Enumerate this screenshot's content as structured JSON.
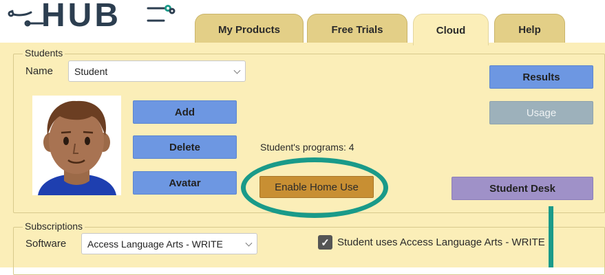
{
  "app": {
    "logo_text": "HUB"
  },
  "tabs": [
    {
      "label": "My Products"
    },
    {
      "label": "Free Trials"
    },
    {
      "label": "Cloud"
    },
    {
      "label": "Help"
    }
  ],
  "students_section": {
    "legend": "Students",
    "name_label": "Name",
    "name_select_value": "Student",
    "buttons": {
      "add": "Add",
      "delete": "Delete",
      "avatar": "Avatar"
    },
    "programs_text": "Student's programs: 4",
    "enable_home_use": "Enable Home Use",
    "results": "Results",
    "usage": "Usage",
    "student_desk": "Student Desk"
  },
  "subscriptions_section": {
    "legend": "Subscriptions",
    "software_label": "Software",
    "software_select_value": "Access Language Arts - WRITE",
    "checkbox_label": "Student uses Access Language Arts - WRITE",
    "checkbox_checked": true
  },
  "colors": {
    "panel": "#fbeeb8",
    "tab": "#e3cf87",
    "button_blue": "#6d97e2",
    "button_disabled": "#9db1bb",
    "button_orange": "#c88f33",
    "button_purple": "#9f91c8",
    "annotation_teal": "#1a9a89"
  }
}
